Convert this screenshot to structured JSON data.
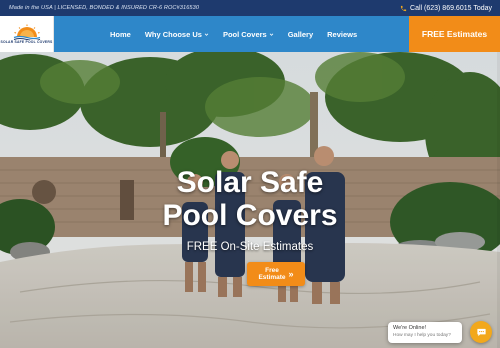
{
  "topbar": {
    "notice": "Made in the USA | LICENSED, BONDED & INSURED CR-6 ROC#316530",
    "phone": "Call (623) 869.6015 Today",
    "phone_icon": "phone-icon"
  },
  "logo": {
    "text": "Solar Safe Pool Covers"
  },
  "nav": {
    "items": [
      {
        "label": "Home",
        "dropdown": false
      },
      {
        "label": "Why Choose Us",
        "dropdown": true
      },
      {
        "label": "Pool Covers",
        "dropdown": true
      },
      {
        "label": "Gallery",
        "dropdown": false
      },
      {
        "label": "Reviews",
        "dropdown": false
      }
    ],
    "cta_label": "FREE Estimates"
  },
  "hero": {
    "title_line1": "Solar Safe",
    "title_line2": "Pool Covers",
    "subtitle": "FREE On-Site Estimates",
    "button_line1": "Free",
    "button_line2": "Estimate",
    "button_arrow": "»"
  },
  "chat": {
    "status": "We're Online!",
    "prompt": "How may I help you today?",
    "icon": "chat-icon"
  },
  "colors": {
    "topbar": "#1e3a6e",
    "nav": "#2e87c9",
    "accent": "#f28c18",
    "chat_button": "#f2a81c"
  }
}
